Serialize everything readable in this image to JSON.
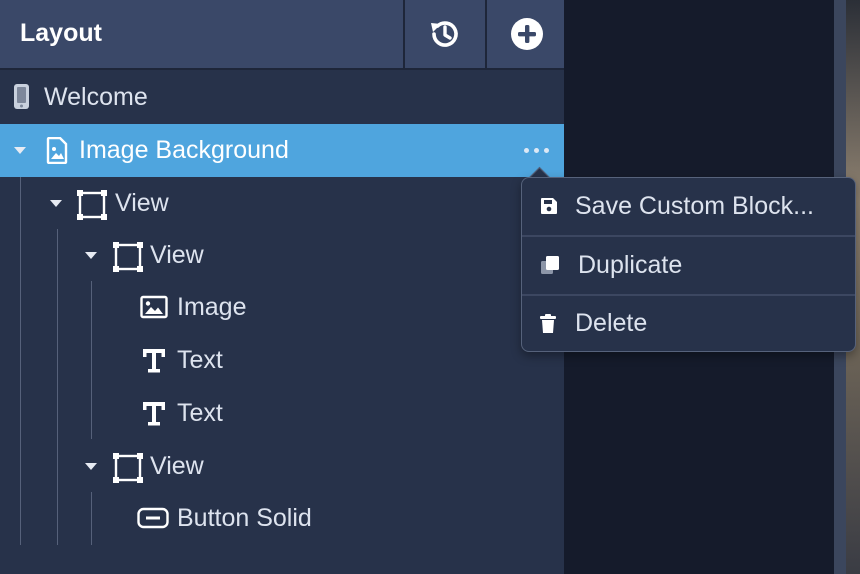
{
  "panel": {
    "title": "Layout",
    "icons": {
      "history": "history-icon",
      "add": "plus-circle-icon"
    }
  },
  "tree": {
    "screen": {
      "label": "Welcome",
      "icon": "phone-icon"
    },
    "selected": {
      "label": "Image Background",
      "icon": "image-file-icon",
      "more_icon": "more-dots-icon"
    },
    "view1": {
      "label": "View",
      "icon": "view-frame-icon"
    },
    "view2": {
      "label": "View",
      "icon": "view-frame-icon"
    },
    "image": {
      "label": "Image",
      "icon": "image-icon"
    },
    "text1": {
      "label": "Text",
      "icon": "text-icon"
    },
    "text2": {
      "label": "Text",
      "icon": "text-icon"
    },
    "view3": {
      "label": "View",
      "icon": "view-frame-icon"
    },
    "button": {
      "label": "Button Solid",
      "icon": "button-icon"
    }
  },
  "menu": {
    "save": {
      "label": "Save Custom Block...",
      "icon": "floppy-disk-icon"
    },
    "duplicate": {
      "label": "Duplicate",
      "icon": "duplicate-icon"
    },
    "delete": {
      "label": "Delete",
      "icon": "trash-icon"
    }
  },
  "colors": {
    "panel_bg": "#27324a",
    "header_bg": "#3a4868",
    "selected_bg": "#4fa5de",
    "text": "#dde3ee",
    "canvas_bg": "#151b2b"
  }
}
